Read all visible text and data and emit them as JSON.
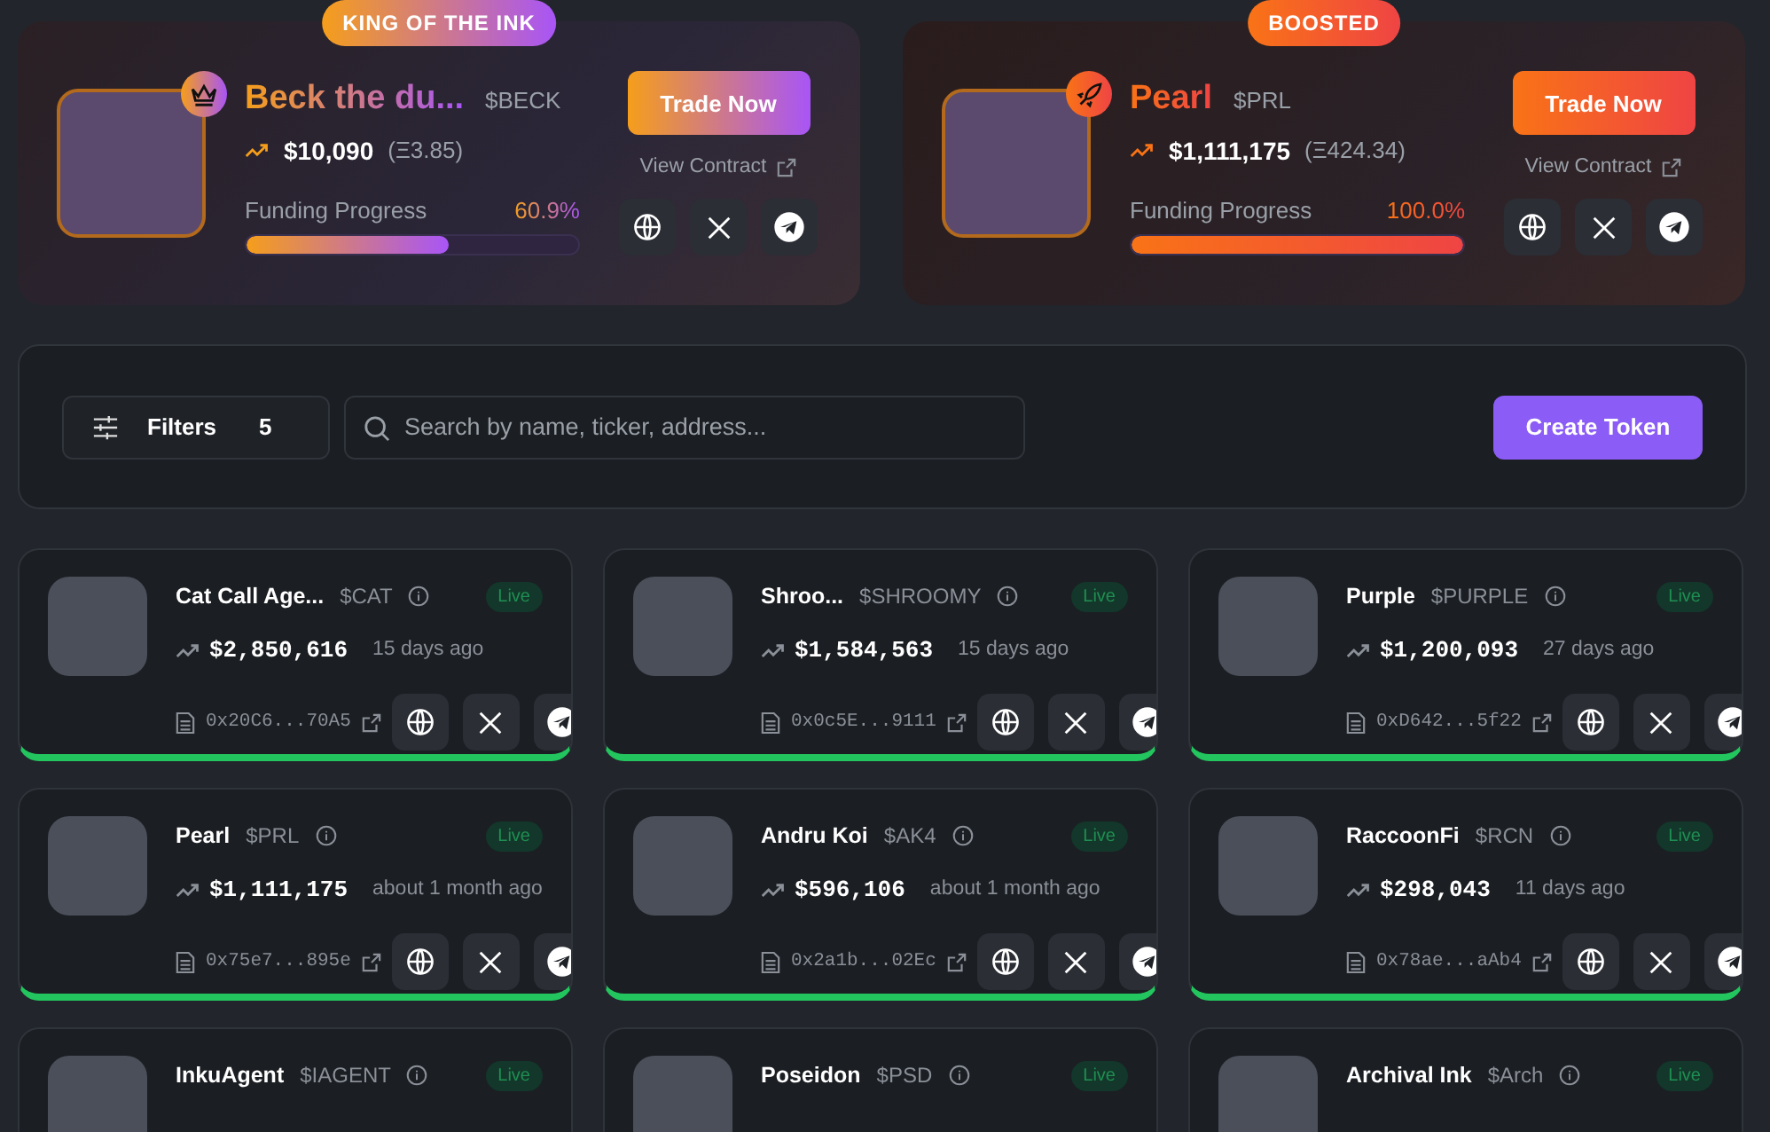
{
  "featured": [
    {
      "kind": "king",
      "badge": "KING OF THE INK",
      "name": "Beck the du...",
      "ticker": "$BECK",
      "price": "$10,090",
      "eth": "(Ξ3.85)",
      "funding_label": "Funding Progress",
      "funding_percent": "60.9%",
      "level": 0.609,
      "trade_button": "Trade Now",
      "view_contract": "View Contract"
    },
    {
      "kind": "boosted",
      "badge": "BOOSTED",
      "name": "Pearl",
      "ticker": "$PRL",
      "price": "$1,111,175",
      "eth": "(Ξ424.34)",
      "funding_label": "Funding Progress",
      "funding_percent": "100.0%",
      "level": 1.0,
      "trade_button": "Trade Now",
      "view_contract": "View Contract"
    }
  ],
  "toolbar": {
    "filters_label": "Filters",
    "filters_count": "5",
    "search": {
      "placeholder": "Search by name, ticker, address..."
    },
    "create_button": "Create Token"
  },
  "tokens": [
    {
      "name": "Cat Call Age...",
      "ticker": "$CAT",
      "status": "Live",
      "price": "$2,850,616",
      "age": "15 days ago",
      "address": "0x20C6...70A5"
    },
    {
      "name": "Shroo...",
      "ticker": "$SHROOMY",
      "status": "Live",
      "price": "$1,584,563",
      "age": "15 days ago",
      "address": "0x0c5E...9111"
    },
    {
      "name": "Purple",
      "ticker": "$PURPLE",
      "status": "Live",
      "price": "$1,200,093",
      "age": "27 days ago",
      "address": "0xD642...5f22"
    },
    {
      "name": "Pearl",
      "ticker": "$PRL",
      "status": "Live",
      "price": "$1,111,175",
      "age": "about 1 month ago",
      "address": "0x75e7...895e"
    },
    {
      "name": "Andru Koi",
      "ticker": "$AK4",
      "status": "Live",
      "price": "$596,106",
      "age": "about 1 month ago",
      "address": "0x2a1b...02Ec"
    },
    {
      "name": "RaccoonFi",
      "ticker": "$RCN",
      "status": "Live",
      "price": "$298,043",
      "age": "11 days ago",
      "address": "0x78ae...aAb4"
    },
    {
      "name": "InkuAgent",
      "ticker": "$IAGENT",
      "status": "Live"
    },
    {
      "name": "Poseidon",
      "ticker": "$PSD",
      "status": "Live"
    },
    {
      "name": "Archival Ink",
      "ticker": "$Arch",
      "status": "Live"
    }
  ]
}
